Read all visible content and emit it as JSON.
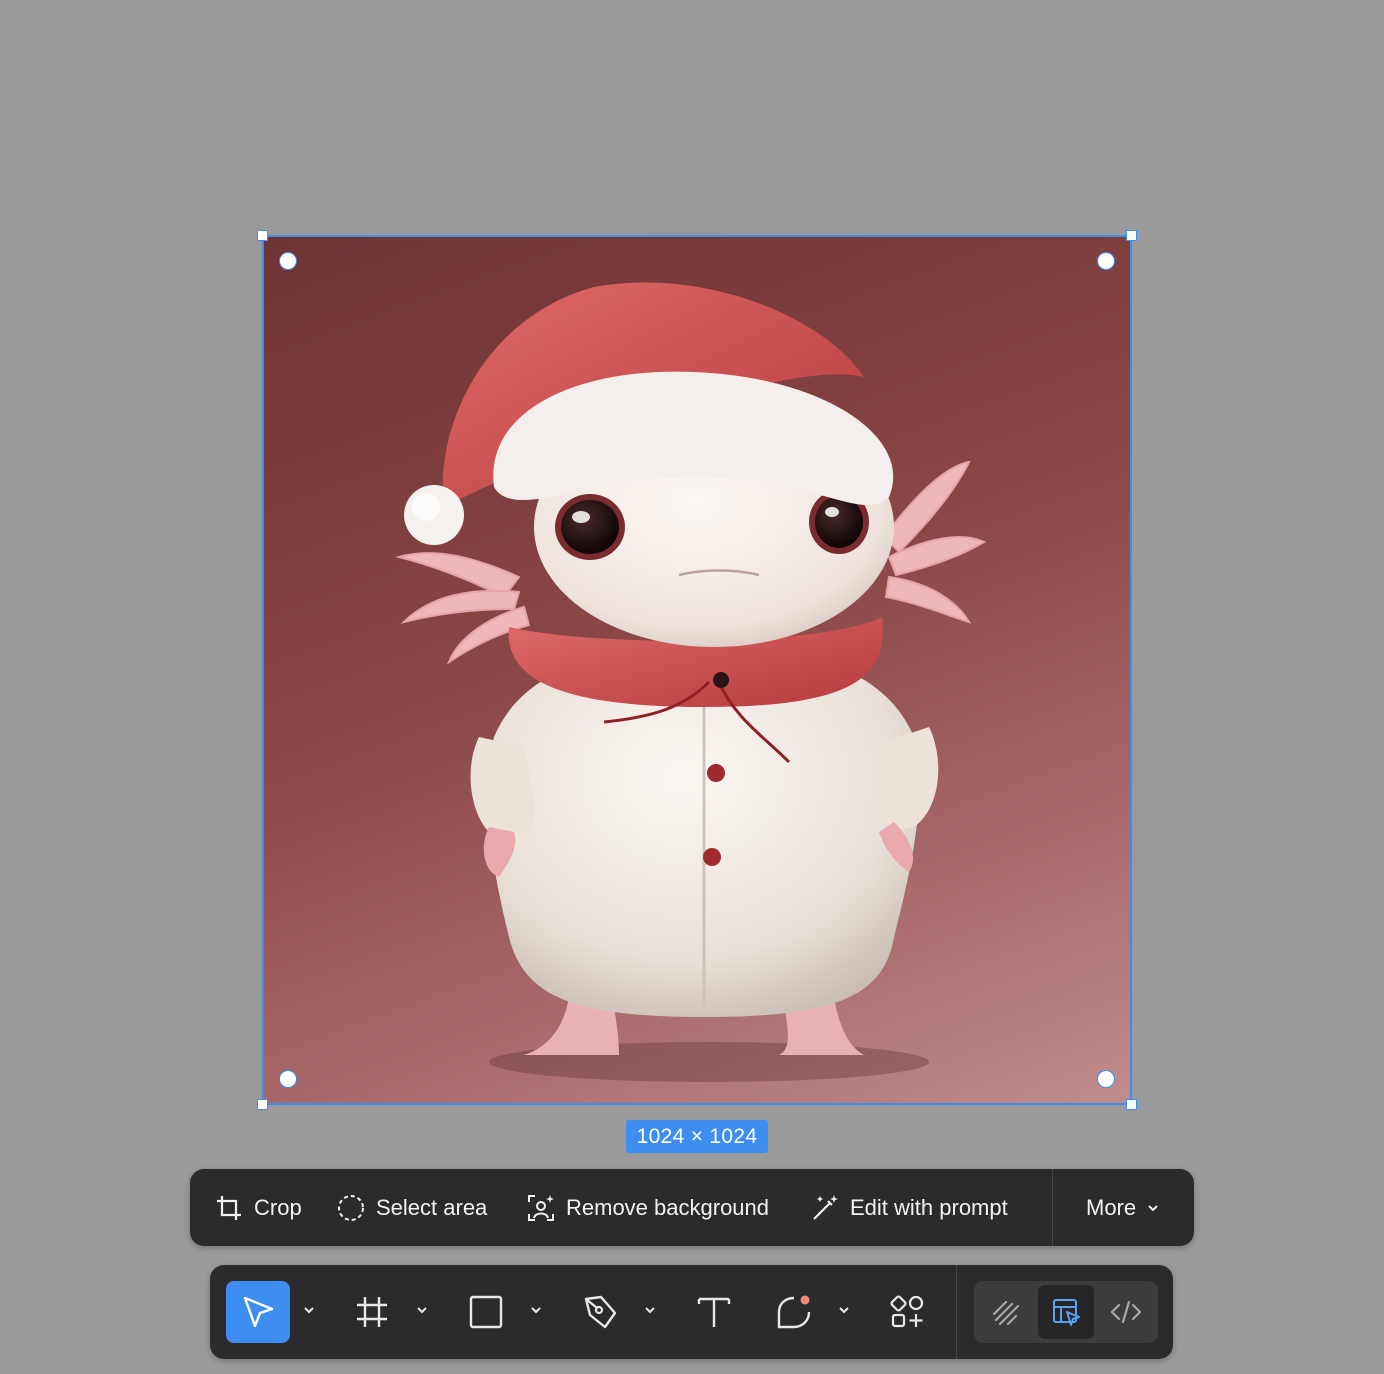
{
  "image": {
    "dimensions_label": "1024 × 1024"
  },
  "action_bar": {
    "crop_label": "Crop",
    "select_area_label": "Select area",
    "remove_background_label": "Remove background",
    "edit_with_prompt_label": "Edit with prompt",
    "more_label": "More"
  },
  "toolbar": {
    "tools": [
      "move-icon",
      "frame-icon",
      "rectangle-icon",
      "pen-icon",
      "text-icon",
      "comment-icon",
      "actions-icon"
    ],
    "modes": [
      "draw-mode-icon",
      "design-mode-icon",
      "dev-mode-icon"
    ],
    "active_tool": "move-icon",
    "active_mode": "design-mode-icon"
  },
  "colors": {
    "accent": "#3d8ef0",
    "toolbar_bg": "#2b2b2b",
    "canvas_bg": "#9a9a9a",
    "comment_dot": "#f08a7e"
  }
}
